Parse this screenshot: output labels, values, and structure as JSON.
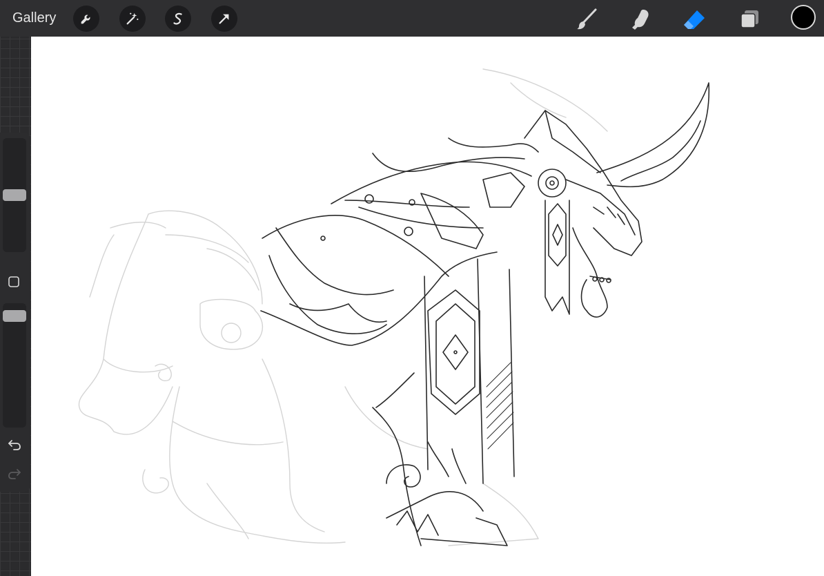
{
  "topbar": {
    "gallery_label": "Gallery",
    "left_tools": [
      {
        "name": "actions",
        "icon": "wrench-icon"
      },
      {
        "name": "adjustments",
        "icon": "magic-wand-icon"
      },
      {
        "name": "selection",
        "icon": "selection-s-icon"
      },
      {
        "name": "transform",
        "icon": "arrow-cursor-icon"
      }
    ],
    "right_tools": [
      {
        "name": "brush",
        "icon": "brush-icon",
        "active": false
      },
      {
        "name": "smudge",
        "icon": "smudge-finger-icon",
        "active": false
      },
      {
        "name": "eraser",
        "icon": "eraser-icon",
        "active": true
      },
      {
        "name": "layers",
        "icon": "layers-icon",
        "active": false
      }
    ],
    "current_color": "#000000"
  },
  "sidebar": {
    "size_slider_level": 0.45,
    "opacity_slider_level": 0.92
  },
  "colors": {
    "accent": "#0a84ff",
    "toolbar_bg": "#2f2f31",
    "canvas_bg": "#ffffff"
  }
}
